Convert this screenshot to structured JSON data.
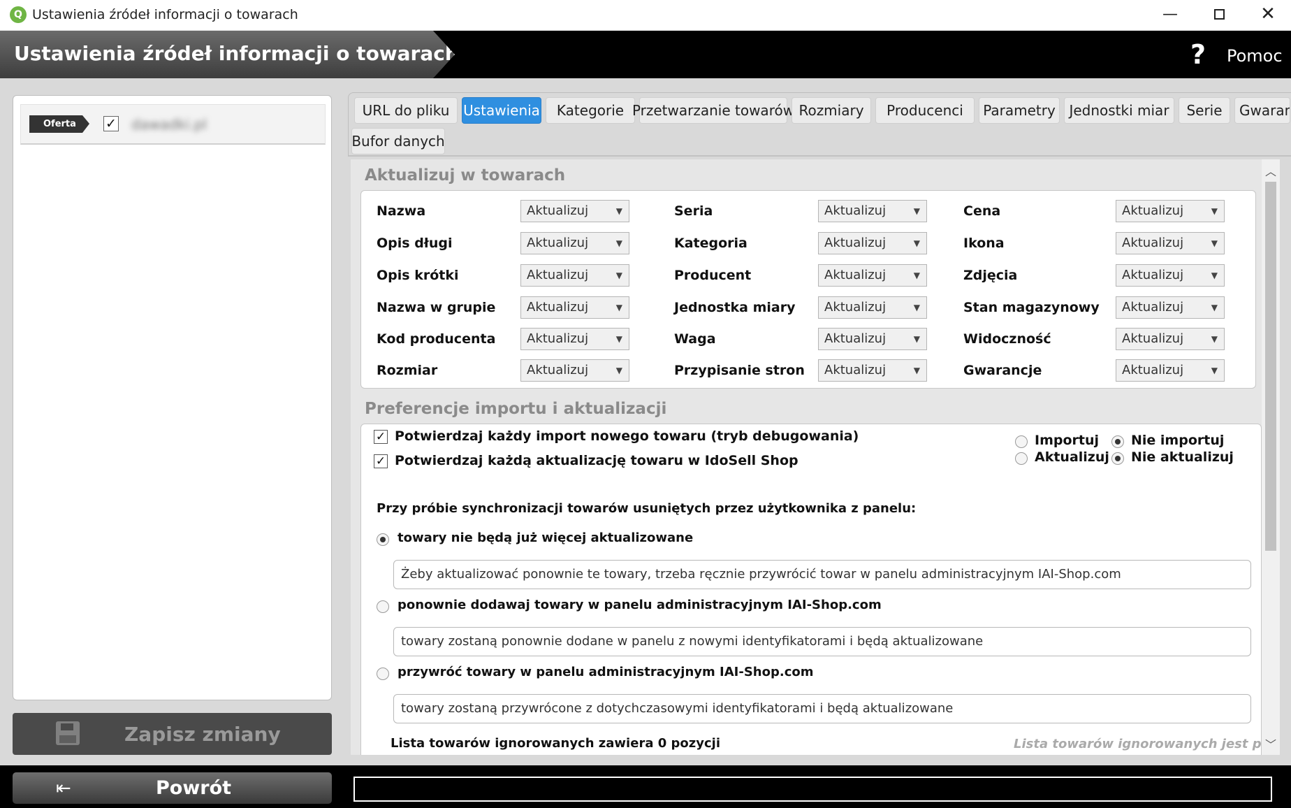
{
  "window": {
    "title": "Ustawienia źródeł informacji o towarach",
    "min": "—",
    "close": "✕"
  },
  "header": {
    "title": "Ustawienia źródeł informacji o towarach",
    "help_icon": "?",
    "help_label": "Pomoc"
  },
  "left": {
    "offer_badge": "Oferta",
    "offer_checked": "✓",
    "offer_name": "dawadki.pl",
    "save_label": "Zapisz zmiany"
  },
  "footer": {
    "back_label": "Powrót",
    "back_icon": "⇤",
    "status": ""
  },
  "tabs": [
    "URL do pliku",
    "Ustawienia",
    "Kategorie",
    "Przetwarzanie towarów",
    "Rozmiary",
    "Producenci",
    "Parametry",
    "Jednostki miar",
    "Serie",
    "Gwarancje",
    "Bufor danych"
  ],
  "active_tab": "Ustawienia",
  "update_section": {
    "title": "Aktualizuj w towarach",
    "columns": [
      [
        {
          "label": "Nazwa",
          "value": "Aktualizuj"
        },
        {
          "label": "Opis długi",
          "value": "Aktualizuj"
        },
        {
          "label": "Opis krótki",
          "value": "Aktualizuj"
        },
        {
          "label": "Nazwa w grupie",
          "value": "Aktualizuj"
        },
        {
          "label": "Kod producenta",
          "value": "Aktualizuj"
        },
        {
          "label": "Rozmiar",
          "value": "Aktualizuj"
        }
      ],
      [
        {
          "label": "Seria",
          "value": "Aktualizuj"
        },
        {
          "label": "Kategoria",
          "value": "Aktualizuj"
        },
        {
          "label": "Producent",
          "value": "Aktualizuj"
        },
        {
          "label": "Jednostka miary",
          "value": "Aktualizuj"
        },
        {
          "label": "Waga",
          "value": "Aktualizuj"
        },
        {
          "label": "Przypisanie stron",
          "value": "Aktualizuj"
        }
      ],
      [
        {
          "label": "Cena",
          "value": "Aktualizuj"
        },
        {
          "label": "Ikona",
          "value": "Aktualizuj"
        },
        {
          "label": "Zdjęcia",
          "value": "Aktualizuj"
        },
        {
          "label": "Stan magazynowy",
          "value": "Aktualizuj"
        },
        {
          "label": "Widoczność",
          "value": "Aktualizuj"
        },
        {
          "label": "Gwarancje",
          "value": "Aktualizuj"
        }
      ]
    ]
  },
  "prefs_section": {
    "title": "Preferencje importu i aktualizacji",
    "check1": "Potwierdzaj każdy import nowego towaru (tryb debugowania)",
    "check2": "Potwierdzaj każdą aktualizację towaru w IdoSell Shop",
    "check_mark": "✓",
    "import_yes": "Importuj",
    "import_no": "Nie importuj",
    "update_yes": "Aktualizuj",
    "update_no": "Nie aktualizuj",
    "sync_question": "Przy próbie synchronizacji towarów usuniętych przez użytkownika z panelu:",
    "option1": "towary nie będą już więcej aktualizowane",
    "option1_desc": "Żeby aktualizować ponownie te towary, trzeba ręcznie przywrócić towar w panelu administracyjnym IAI-Shop.com",
    "option2": "ponownie dodawaj towary w panelu administracyjnym IAI-Shop.com",
    "option2_desc": "towary zostaną ponownie dodane w panelu z nowymi identyfikatorami i będą aktualizowane",
    "option3": "przywróć towary w panelu administracyjnym IAI-Shop.com",
    "option3_desc": "towary zostaną przywrócone z dotychczasowymi identyfikatorami i będą aktualizowane",
    "ignored_count": "Lista towarów ignorowanych zawiera 0 pozycji",
    "ignored_empty": "Lista towarów ignorowanych jest pusta"
  },
  "colors": {
    "active_tab": "#2f8fe0",
    "header_bg": "#000000",
    "panel_bg": "#d9d9d9"
  }
}
